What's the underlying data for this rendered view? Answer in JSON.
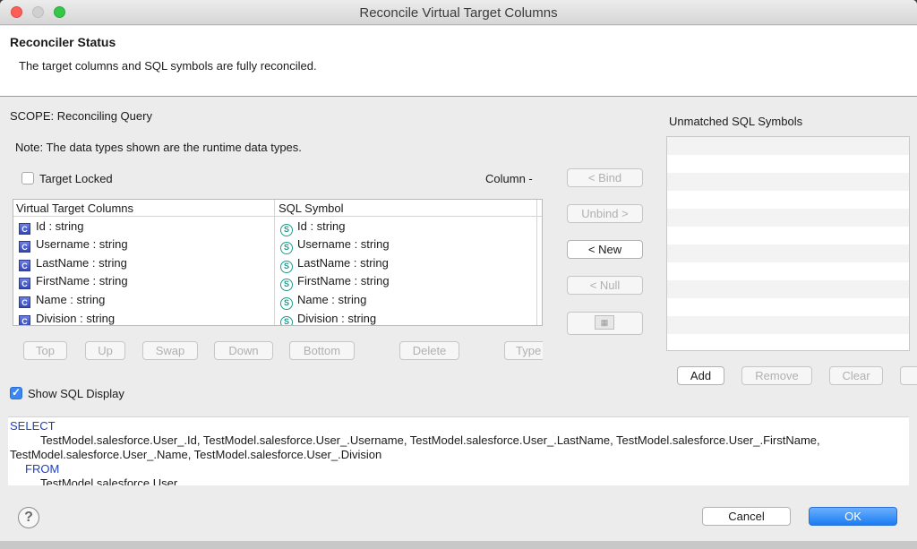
{
  "window": {
    "title": "Reconcile Virtual Target Columns"
  },
  "status": {
    "heading": "Reconciler Status",
    "message": "The target columns and SQL symbols are fully reconciled."
  },
  "scope_label": "SCOPE: Reconciling Query",
  "note": "Note: The data types shown are the runtime data types.",
  "target_locked": {
    "label": "Target Locked",
    "checked": false
  },
  "column_label": "Column -",
  "table": {
    "headers": {
      "col1": "Virtual Target Columns",
      "col2": "SQL Symbol"
    },
    "rows": [
      {
        "target": "Id : string",
        "symbol": "Id : string"
      },
      {
        "target": "Username : string",
        "symbol": "Username : string"
      },
      {
        "target": "LastName : string",
        "symbol": "LastName : string"
      },
      {
        "target": "FirstName : string",
        "symbol": "FirstName : string"
      },
      {
        "target": "Name : string",
        "symbol": "Name : string"
      },
      {
        "target": "Division : string",
        "symbol": "Division : string"
      }
    ]
  },
  "row_buttons": {
    "top": "Top",
    "up": "Up",
    "swap": "Swap",
    "down": "Down",
    "bottom": "Bottom",
    "delete": "Delete",
    "type": "Type"
  },
  "middle_buttons": {
    "bind": "< Bind",
    "unbind": "Unbind >",
    "new": "< New",
    "null": "< Null"
  },
  "unmatched": {
    "title": "Unmatched SQL Symbols",
    "add": "Add",
    "remove": "Remove",
    "clear": "Clear"
  },
  "show_sql": {
    "label": "Show SQL Display",
    "checked": true
  },
  "sql": {
    "line1": "SELECT",
    "line2": "TestModel.salesforce.User_.Id, TestModel.salesforce.User_.Username, TestModel.salesforce.User_.LastName, TestModel.salesforce.User_.FirstName,",
    "line3": "TestModel.salesforce.User_.Name, TestModel.salesforce.User_.Division",
    "line4": "FROM",
    "line5": "TestModel.salesforce.User"
  },
  "footer": {
    "cancel": "Cancel",
    "ok": "OK",
    "help": "?"
  },
  "icons": {
    "column_icon": "C",
    "symbol_icon": "S"
  },
  "colors": {
    "accent": "#1c7cf2",
    "keyword": "#1f3fc4",
    "symbol": "#1f9c8a"
  }
}
